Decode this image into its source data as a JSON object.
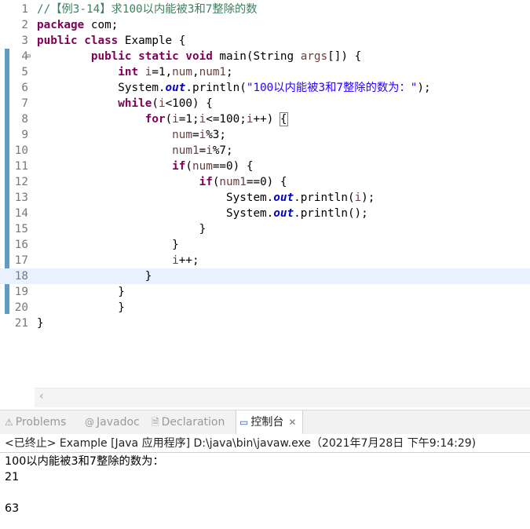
{
  "editor": {
    "lines": [
      {
        "n": "1",
        "html": "<span class='cmt'>//【例3-14】求100以内能被3和7整除的数</span>"
      },
      {
        "n": "2",
        "html": "<span class='kw'>package</span> com;"
      },
      {
        "n": "3",
        "html": "<span class='kw'>public class</span> Example {"
      },
      {
        "n": "4",
        "fold": "⊖",
        "html": "        <span class='kw'>public static void</span> main(String <span class='var'>args</span>[]) {"
      },
      {
        "n": "5",
        "html": "            <span class='kw'>int</span> <span class='var'>i</span>=1,<span class='var'>num</span>,<span class='var'>num1</span>;"
      },
      {
        "n": "6",
        "html": "            System.<span class='fld'>out</span>.println(<span class='str'>\"100以内能被3和7整除的数为：\"</span>);"
      },
      {
        "n": "7",
        "html": "            <span class='kw'>while</span>(<span class='var'>i</span>&lt;100) {"
      },
      {
        "n": "8",
        "html": "                <span class='kw'>for</span>(<span class='var'>i</span>=1;<span class='var'>i</span>&lt;=100;<span class='var'>i</span>++) <span class='brace-box'>{</span>"
      },
      {
        "n": "9",
        "html": "                    <span class='var'>num</span>=<span class='var'>i</span>%3;"
      },
      {
        "n": "10",
        "html": "                    <span class='var'>num1</span>=<span class='var'>i</span>%7;"
      },
      {
        "n": "11",
        "html": "                    <span class='kw'>if</span>(<span class='var'>num</span>==0) {"
      },
      {
        "n": "12",
        "html": "                        <span class='kw'>if</span>(<span class='var'>num1</span>==0) {"
      },
      {
        "n": "13",
        "html": "                            System.<span class='fld'>out</span>.println(<span class='var'>i</span>);"
      },
      {
        "n": "14",
        "html": "                            System.<span class='fld'>out</span>.println();"
      },
      {
        "n": "15",
        "html": "                        }"
      },
      {
        "n": "16",
        "html": "                    }"
      },
      {
        "n": "17",
        "html": "                    <span class='var'>i</span>++;"
      },
      {
        "n": "18",
        "current": true,
        "html": "                }"
      },
      {
        "n": "19",
        "html": "            }"
      },
      {
        "n": "20",
        "html": "            }"
      },
      {
        "n": "21",
        "html": "}"
      }
    ]
  },
  "tabs": [
    {
      "label": "Problems",
      "icon": "⚠",
      "name": "problems"
    },
    {
      "label": "Javadoc",
      "icon": "@",
      "name": "javadoc"
    },
    {
      "label": "Declaration",
      "icon": "🗎",
      "name": "declaration"
    },
    {
      "label": "控制台",
      "icon": "▭",
      "name": "console",
      "active": true,
      "close": "✕"
    }
  ],
  "console": {
    "header": "<已终止> Example [Java 应用程序] D:\\java\\bin\\javaw.exe（2021年7月28日 下午9:14:29)",
    "output": [
      "100以内能被3和7整除的数为：",
      "21",
      "",
      "63"
    ]
  }
}
